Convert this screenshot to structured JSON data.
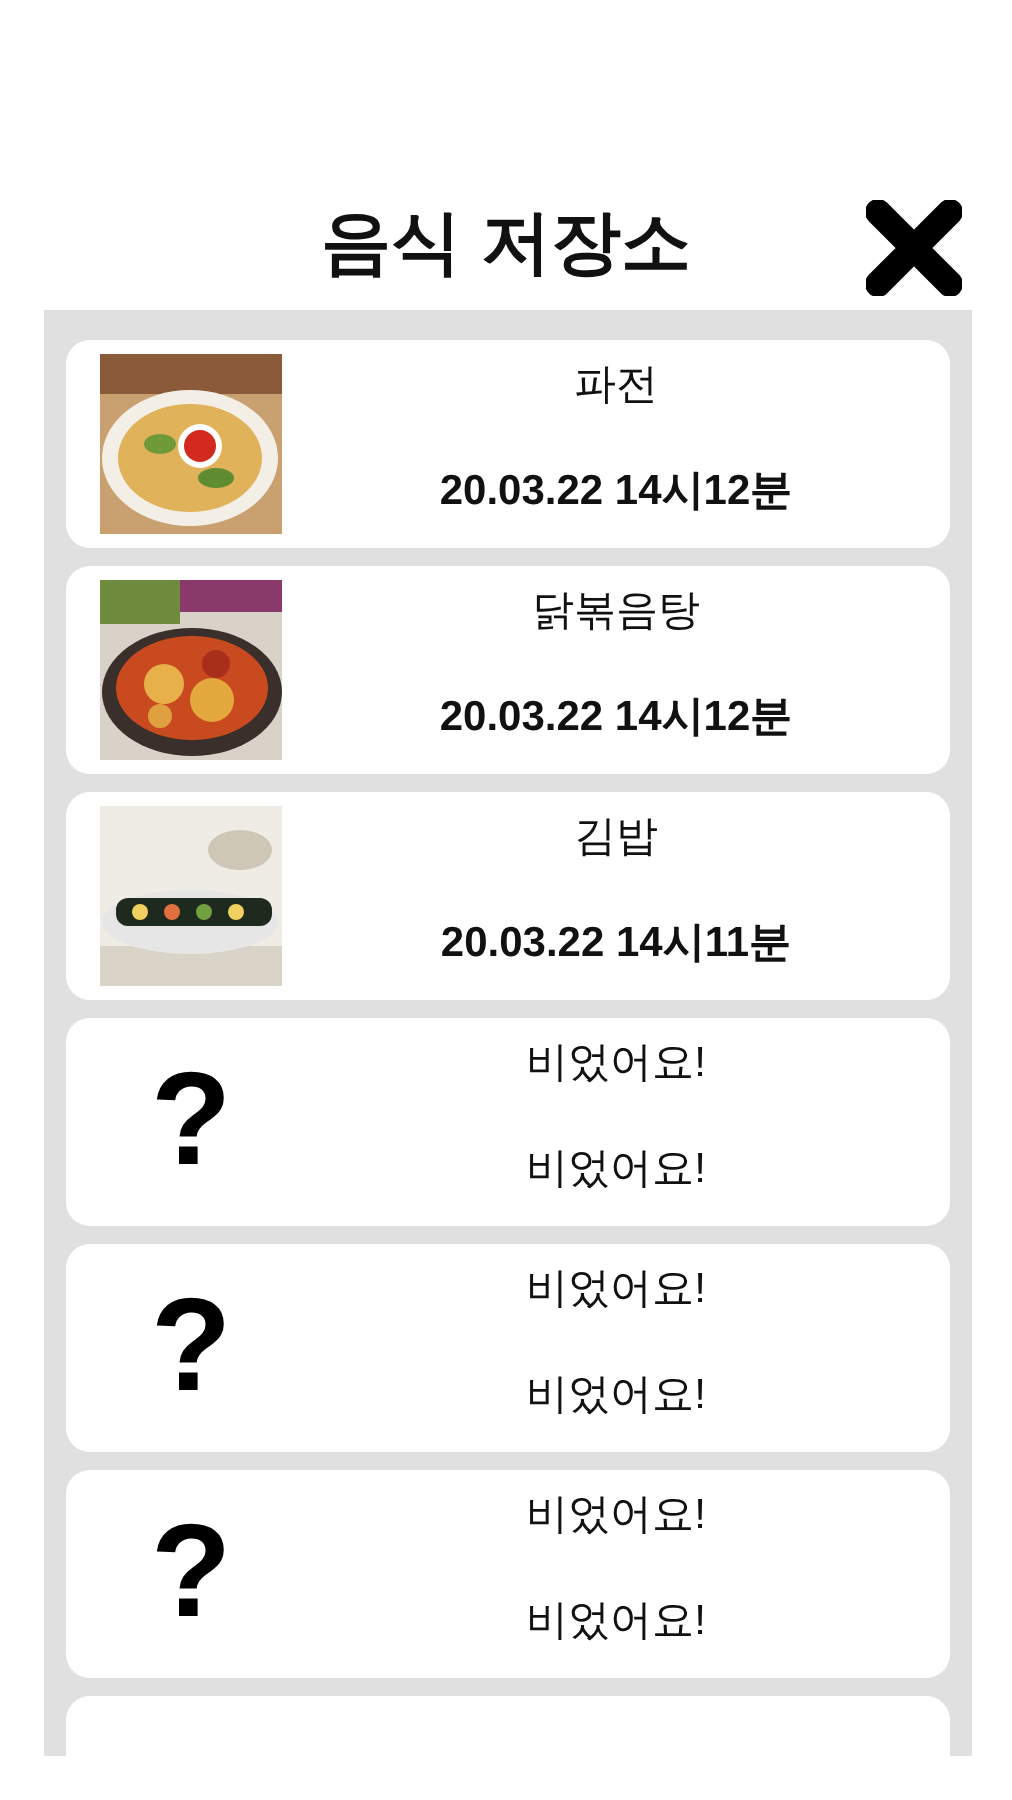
{
  "title": "음식 저장소",
  "items": [
    {
      "kind": "food",
      "name": "파전",
      "date": "20.03.22 14시12분"
    },
    {
      "kind": "food",
      "name": "닭볶음탕",
      "date": "20.03.22 14시12분"
    },
    {
      "kind": "food",
      "name": "김밥",
      "date": "20.03.22 14시11분"
    },
    {
      "kind": "empty",
      "symbol": "?",
      "name": "비었어요!",
      "date": "비었어요!"
    },
    {
      "kind": "empty",
      "symbol": "?",
      "name": "비었어요!",
      "date": "비었어요!"
    },
    {
      "kind": "empty",
      "symbol": "?",
      "name": "비었어요!",
      "date": "비었어요!"
    },
    {
      "kind": "empty"
    }
  ]
}
